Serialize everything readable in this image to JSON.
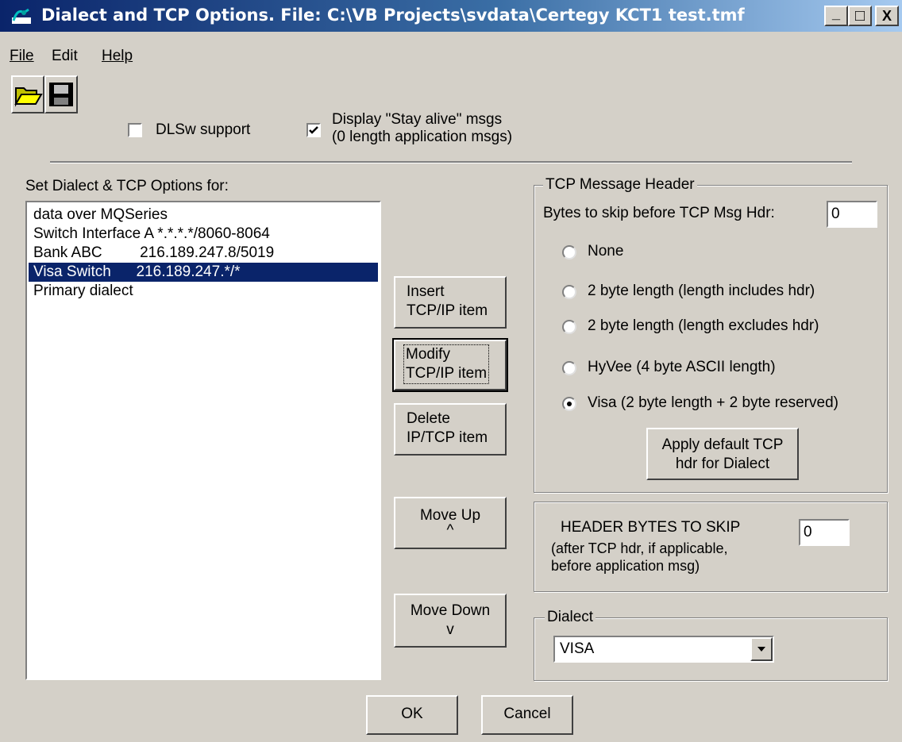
{
  "window": {
    "title": "Dialect and TCP Options. File: C:\\VB Projects\\svdata\\Certegy KCT1 test.tmf",
    "minimize": "_",
    "maximize": "□",
    "close": "X"
  },
  "menu": [
    {
      "label": "File"
    },
    {
      "label": "Edit"
    },
    {
      "label": "Help"
    }
  ],
  "toolbar": {
    "open_icon": "folder-open-icon",
    "save_icon": "floppy-disk-icon"
  },
  "options": {
    "dlsw_label": "DLSw support",
    "dlsw_checked": false,
    "stay_alive_label_line1": "Display \"Stay alive\" msgs",
    "stay_alive_label_line2": "(0 length application msgs)",
    "stay_alive_checked": true
  },
  "list": {
    "label": "Set Dialect & TCP Options for:",
    "items": [
      "data over MQSeries",
      "Switch Interface A *.*.*.*/8060-8064",
      "Bank ABC         216.189.247.8/5019",
      "Visa Switch      216.189.247.*/*",
      "Primary dialect"
    ],
    "selected_index": 3
  },
  "buttons": {
    "insert_line1": "Insert",
    "insert_line2": "TCP/IP item",
    "modify_line1": "Modify",
    "modify_line2": "TCP/IP item",
    "delete_line1": "Delete",
    "delete_line2": "IP/TCP item",
    "move_up_line1": "Move Up",
    "move_up_line2": "^",
    "move_down_line1": "Move Down",
    "move_down_line2": "v",
    "ok": "OK",
    "cancel": "Cancel"
  },
  "tcp_header": {
    "title": "TCP Message Header",
    "skip_label": "Bytes to skip before TCP Msg Hdr:",
    "skip_value": "0",
    "radios": [
      {
        "label": "None",
        "checked": false
      },
      {
        "label": "2 byte length (length includes hdr)",
        "checked": false
      },
      {
        "label": "2 byte length (length excludes hdr)",
        "checked": false
      },
      {
        "label": "HyVee (4 byte ASCII length)",
        "checked": false
      },
      {
        "label": "Visa (2 byte length + 2 byte reserved)",
        "checked": true
      }
    ],
    "apply_line1": "Apply default TCP",
    "apply_line2": "hdr for Dialect"
  },
  "header_skip": {
    "title": "HEADER BYTES TO SKIP",
    "note_line1": "(after TCP hdr, if applicable,",
    "note_line2": "before application msg)",
    "value": "0"
  },
  "dialect": {
    "title": "Dialect",
    "selected": "VISA"
  }
}
